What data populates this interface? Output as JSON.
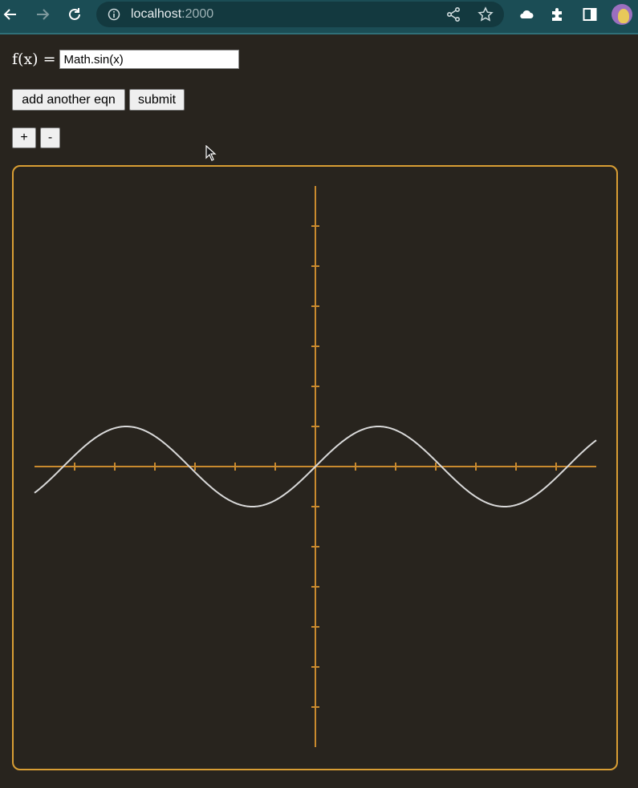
{
  "browser": {
    "url_host": "localhost",
    "url_port": ":2000",
    "icons": [
      "back-icon",
      "forward-icon",
      "reload-icon",
      "info-icon",
      "share-icon",
      "star-icon",
      "cloud-icon",
      "extensions-icon",
      "side-panel-icon",
      "profile-avatar"
    ]
  },
  "form": {
    "fx_label": "f(x) =",
    "equation_value": "Math.sin(x)",
    "add_button": "add another eqn",
    "submit_button": "submit",
    "zoom_in_button": "+",
    "zoom_out_button": "-"
  },
  "colors": {
    "background": "#28241e",
    "axis": "#c98a2e",
    "border": "#d99e34",
    "curve": "#d9d9d9"
  },
  "chart_data": {
    "type": "line",
    "function": "Math.sin(x)",
    "xlim": [
      -7,
      7
    ],
    "ylim": [
      -7,
      7
    ],
    "x_ticks": [
      -6,
      -5,
      -4,
      -3,
      -2,
      -1,
      1,
      2,
      3,
      4,
      5,
      6
    ],
    "y_ticks": [
      -6,
      -5,
      -4,
      -3,
      -2,
      -1,
      1,
      2,
      3,
      4,
      5,
      6
    ],
    "series": [
      {
        "expression": "Math.sin(x)",
        "x_range": [
          -7,
          7
        ]
      }
    ]
  }
}
